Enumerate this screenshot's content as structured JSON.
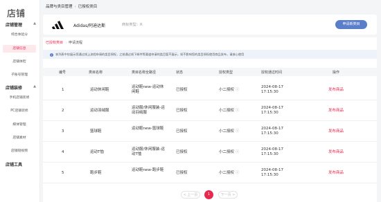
{
  "sidebar": {
    "title": "店铺",
    "groups": [
      {
        "label": "店铺管理",
        "items": [
          "综合体验分",
          "店铺信息",
          "店铺体检",
          "子账号管理"
        ]
      },
      {
        "label": "店铺装修",
        "items": [
          "手机店铺装修",
          "PC店铺装修",
          "媒体管理",
          "店铺素材",
          "店铺短视频"
        ]
      },
      {
        "label": "店铺工具",
        "items": []
      }
    ],
    "active_item": "店铺信息"
  },
  "breadcrumb": {
    "parent": "品牌与类目管理",
    "current": "已授权类目"
  },
  "brand": {
    "name": "Adidas/阿迪达斯",
    "type": "商标类型：R",
    "apply_button": "申请新类目"
  },
  "tabs": {
    "active": "已授权类目",
    "other": "申请流程"
  },
  "notice": "本列表中仅展示您通过线上流程申请的类目授权，之前通过线下邮件等渠道申请的类目暂不展示，如不影响您的类目授权使用商品发布，请放心使用",
  "table": {
    "headers": [
      "编号",
      "类目名称",
      "类目名称全路径",
      "状态",
      "授权类型",
      "授权通过时间",
      "操作"
    ],
    "rows": [
      {
        "id": "1",
        "name": "运动休闲鞋",
        "path": "运动鞋new-运动休闲鞋",
        "status": "已授权",
        "auth": "小二授权",
        "time": "2024-08-17 17:15:30",
        "action": "发布商品"
      },
      {
        "id": "2",
        "name": "运动羽绒服",
        "path": "运动服/休闲服装-运动羽绒服",
        "status": "已授权",
        "auth": "小二授权",
        "time": "2024-08-17 17:15:30",
        "action": "发布商品"
      },
      {
        "id": "3",
        "name": "篮球鞋",
        "path": "运动鞋new-篮球鞋",
        "status": "已授权",
        "auth": "小二授权",
        "time": "2024-08-17 17:15:30",
        "action": "发布商品"
      },
      {
        "id": "4",
        "name": "运动T恤",
        "path": "运动服/休闲服装-运动T恤",
        "status": "已授权",
        "auth": "小二授权",
        "time": "2024-08-17 17:15:30",
        "action": "发布商品"
      },
      {
        "id": "5",
        "name": "跑步鞋",
        "path": "运动鞋new-跑步鞋",
        "status": "已授权",
        "auth": "小二授权",
        "time": "2024-08-17 17:15:30",
        "action": "发布商品"
      }
    ]
  },
  "pagination": {
    "prev": "< 上一页",
    "current": "1",
    "next": "下一页 >"
  },
  "colors": {
    "accent": "#e8294f",
    "primary": "#5a7ec9"
  }
}
